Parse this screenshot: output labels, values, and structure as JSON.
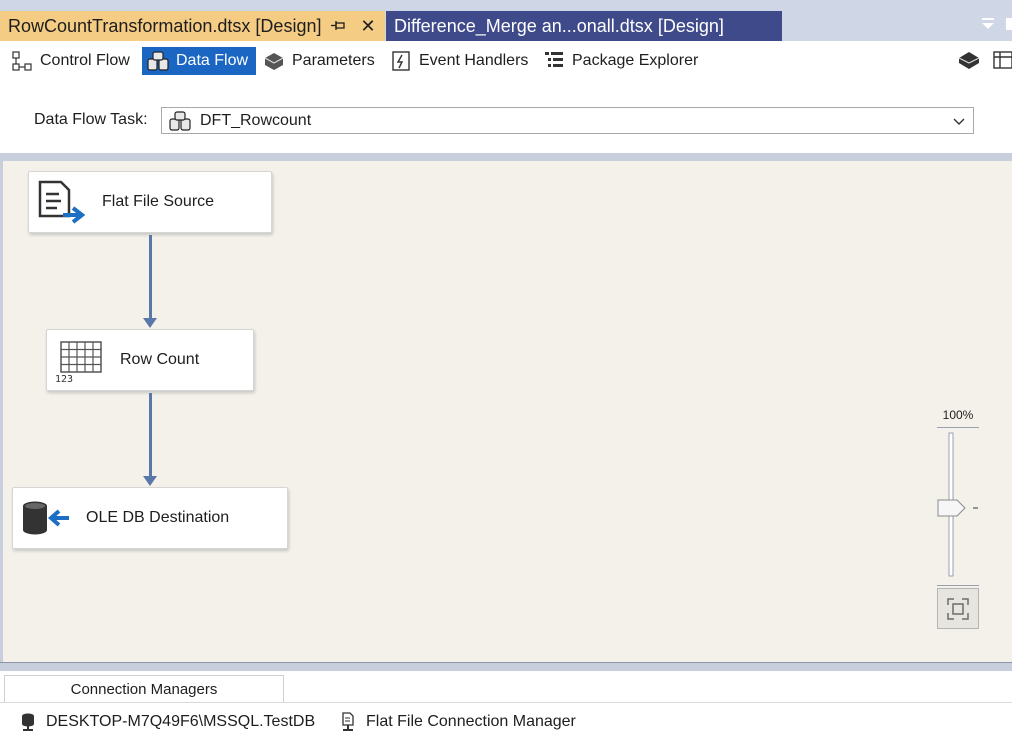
{
  "tabs": {
    "active": {
      "title": "RowCountTransformation.dtsx [Design]",
      "close": "✕"
    },
    "inactive": {
      "title": "Difference_Merge an...onall.dtsx [Design]"
    }
  },
  "designer_tabs": [
    {
      "label": "Control Flow",
      "icon": "control-flow-icon"
    },
    {
      "label": "Data Flow",
      "icon": "data-flow-icon",
      "active": true
    },
    {
      "label": "Parameters",
      "icon": "parameters-icon"
    },
    {
      "label": "Event Handlers",
      "icon": "event-handlers-icon"
    },
    {
      "label": "Package Explorer",
      "icon": "package-explorer-icon"
    }
  ],
  "task": {
    "label": "Data Flow Task:",
    "value": "DFT_Rowcount"
  },
  "components": {
    "source": {
      "label": "Flat File Source",
      "icon": "flat-file-source-icon"
    },
    "rowcount": {
      "label": "Row Count",
      "icon": "row-count-icon"
    },
    "destination": {
      "label": "OLE DB Destination",
      "icon": "ole-db-destination-icon"
    }
  },
  "zoom": {
    "label": "100%",
    "level_percent": 100
  },
  "connection_managers": {
    "tab_label": "Connection Managers",
    "items": [
      {
        "label": "DESKTOP-M7Q49F6\\MSSQL.TestDB",
        "icon": "ole-db-connection-icon"
      },
      {
        "label": "Flat File Connection Manager",
        "icon": "flat-file-connection-icon"
      }
    ]
  },
  "colors": {
    "active_tab": "#f5cc84",
    "inactive_tab": "#3f4a8a",
    "selected_toolbar": "#1a66c2",
    "canvas": "#f3f1ea",
    "path_arrow": "#5a77aa"
  }
}
